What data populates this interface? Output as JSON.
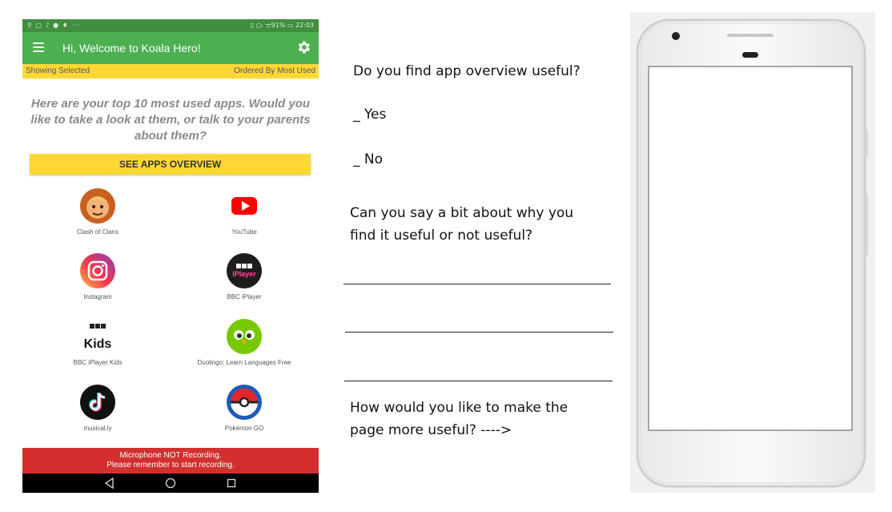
{
  "status_bar": {
    "left_icons": "⚲ ▢ ♪ ● ♦ ···",
    "right": "▯ ○ᵣ ᯤ91% ▭ 22:03"
  },
  "app_bar": {
    "title": "Hi, Welcome to Koala Hero!",
    "menu_icon": "menu-icon",
    "settings_icon": "gear-icon"
  },
  "filter_bar": {
    "left": "Showing Selected",
    "right": "Ordered By Most Used"
  },
  "intro_text": "Here are your top 10 most used apps. Would you like to take a look at them, or talk to your parents about them?",
  "overview_button": "SEE APPS OVERVIEW",
  "apps": [
    {
      "name": "Clash of Clans",
      "icon": "clash-of-clans-icon",
      "color": "#e07a2e"
    },
    {
      "name": "YouTube",
      "icon": "youtube-icon",
      "color": "#ff0000"
    },
    {
      "name": "Instagram",
      "icon": "instagram-icon",
      "color": "#d6249f"
    },
    {
      "name": "BBC iPlayer",
      "icon": "bbc-iplayer-icon",
      "color": "#1d1d1b",
      "badge": "BBC",
      "text": "iPlayer"
    },
    {
      "name": "BBC iPlayer Kids",
      "icon": "bbc-iplayer-kids-icon",
      "color": "#111111",
      "badge": "BBC",
      "text": "Kids"
    },
    {
      "name": "Duolingo: Learn Languages Free",
      "icon": "duolingo-icon",
      "color": "#78c800"
    },
    {
      "name": "musical.ly",
      "icon": "musically-icon",
      "color": "#111111"
    },
    {
      "name": "Pokémon GO",
      "icon": "pokemon-go-icon",
      "color": "#1e5bb8"
    }
  ],
  "mic_banner": {
    "line1": "Microphone NOT Recording.",
    "line2": "Please remember to start recording."
  },
  "nav_bar": {
    "back_icon": "back-icon",
    "home_icon": "home-icon",
    "recents_icon": "recents-icon"
  },
  "questionnaire": {
    "q1": "Do you find app overview useful?",
    "opt_yes": "_ Yes",
    "opt_no": "_ No",
    "q2_line1": "Can you say a bit about why you",
    "q2_line2": "find it useful or not useful?",
    "q3_line1": "How would you like to make the",
    "q3_line2": "page more useful? ---->"
  },
  "colors": {
    "green": "#4caf50",
    "yellow": "#fdd835",
    "red": "#d32f2f"
  }
}
